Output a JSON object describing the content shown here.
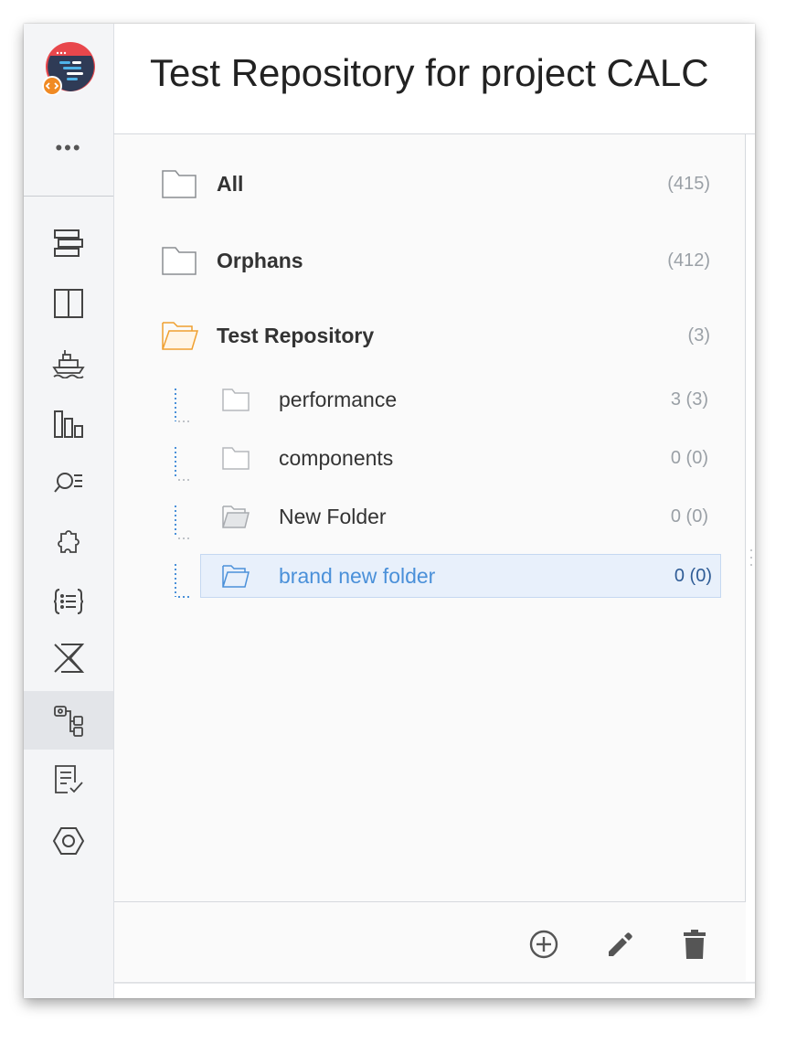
{
  "header": {
    "title": "Test Repository for project CALC"
  },
  "sidebar": {
    "more_label": "•••",
    "logo_icon": "app-logo-icon",
    "items": [
      {
        "icon": "board-icon"
      },
      {
        "icon": "columns-icon"
      },
      {
        "icon": "ship-icon"
      },
      {
        "icon": "reports-icon"
      },
      {
        "icon": "search-list-icon"
      },
      {
        "icon": "puzzle-icon"
      },
      {
        "icon": "code-list-icon"
      },
      {
        "icon": "xray-icon"
      },
      {
        "icon": "test-repository-icon",
        "active": true
      },
      {
        "icon": "test-plan-icon"
      },
      {
        "icon": "settings-hex-icon"
      }
    ]
  },
  "tree": {
    "top": [
      {
        "label": "All",
        "count": "(415)"
      },
      {
        "label": "Orphans",
        "count": "(412)"
      },
      {
        "label": "Test Repository",
        "count": "(3)"
      }
    ],
    "children": [
      {
        "label": "performance",
        "count": "3 (3)"
      },
      {
        "label": "components",
        "count": "0 (0)"
      },
      {
        "label": "New Folder",
        "count": "0 (0)"
      },
      {
        "label": "brand new folder",
        "count": "0 (0)",
        "selected": true
      }
    ]
  },
  "colors": {
    "accent": "#4a90d9",
    "open_folder": "#f0a030",
    "logo_red": "#e8474c",
    "logo_navy": "#2f3b56",
    "logo_orange": "#f08a24"
  },
  "footer": {
    "actions": [
      "add-circle-icon",
      "pencil-icon",
      "trash-icon"
    ]
  }
}
